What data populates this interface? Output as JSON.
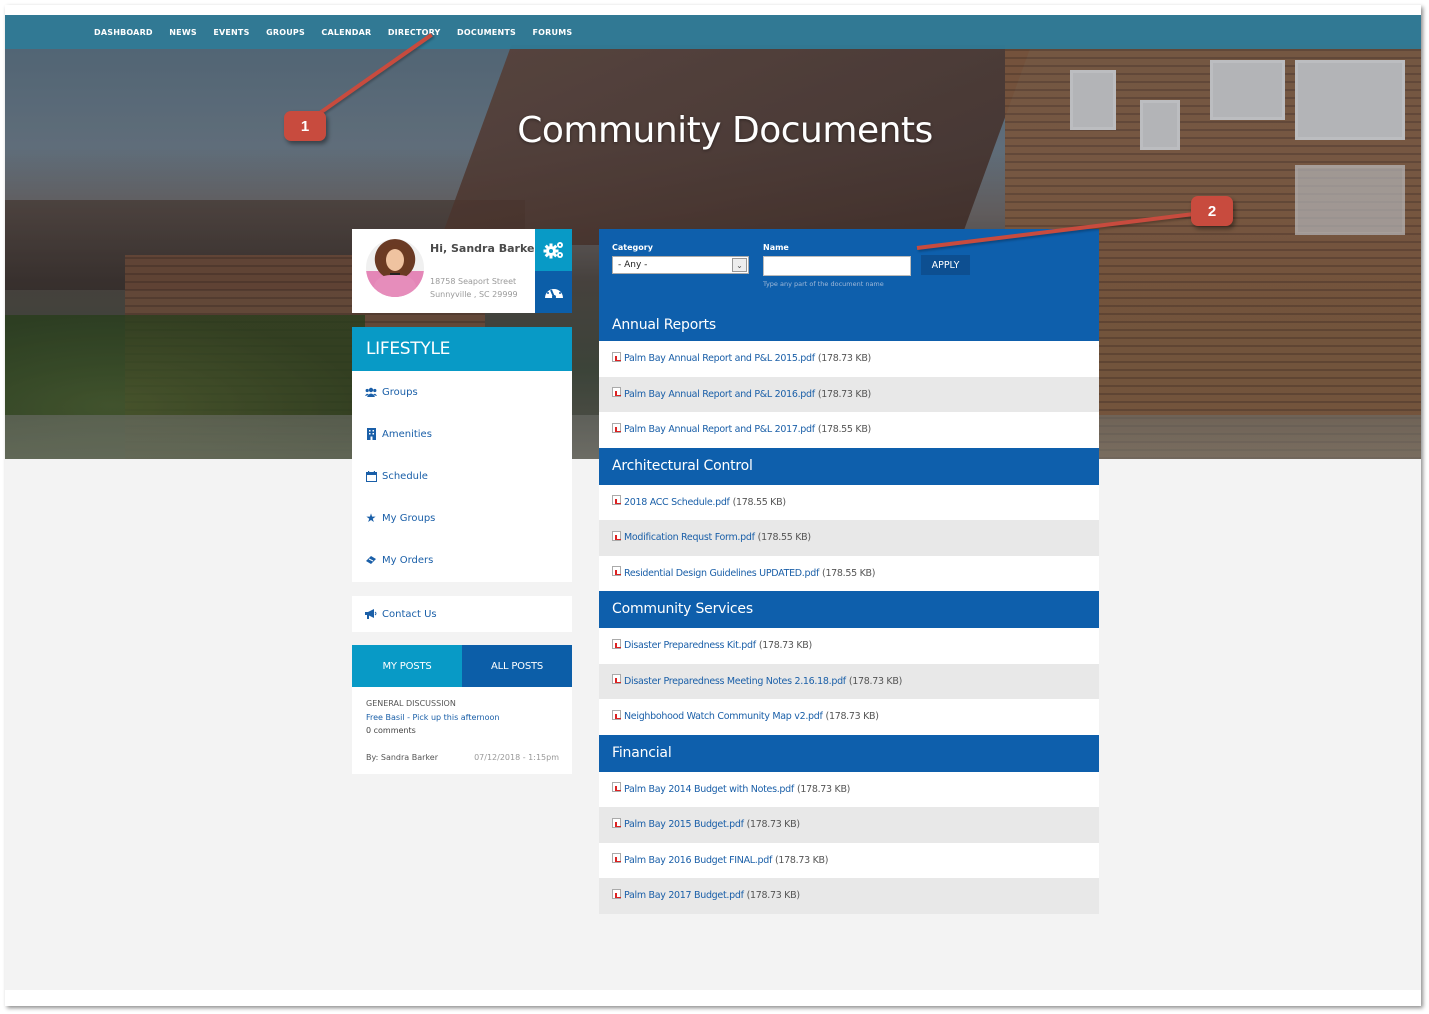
{
  "nav": {
    "items": [
      "DASHBOARD",
      "NEWS",
      "EVENTS",
      "GROUPS",
      "CALENDAR",
      "DIRECTORY",
      "DOCUMENTS",
      "FORUMS"
    ]
  },
  "hero": {
    "title": "Community Documents"
  },
  "callouts": [
    "1",
    "2"
  ],
  "profile": {
    "greeting": "Hi, Sandra Barker",
    "address_line1": "18758 Seaport Street",
    "address_line2": "Sunnyville , SC 29999",
    "settings_icon": "gears-icon",
    "dashboard_icon": "speedometer-icon"
  },
  "sidebar": {
    "heading": "LIFESTYLE",
    "items": [
      {
        "label": "Groups",
        "icon": "users-icon"
      },
      {
        "label": "Amenities",
        "icon": "building-icon"
      },
      {
        "label": "Schedule",
        "icon": "calendar-icon"
      },
      {
        "label": "My Groups",
        "icon": "star-icon"
      },
      {
        "label": "My Orders",
        "icon": "ticket-icon"
      }
    ],
    "contact": {
      "label": "Contact Us",
      "icon": "megaphone-icon"
    }
  },
  "posts": {
    "tabs": [
      "MY POSTS",
      "ALL POSTS"
    ],
    "item": {
      "category": "GENERAL DISCUSSION",
      "title": "Free Basil - Pick up this afternoon",
      "comments": "0 comments",
      "author": "By: Sandra Barker",
      "date": "07/12/2018 - 1:15pm"
    }
  },
  "filter": {
    "category_label": "Category",
    "category_value": "- Any -",
    "name_label": "Name",
    "name_value": "",
    "name_hint": "Type any part of the document name",
    "apply_label": "APPLY"
  },
  "sections": [
    {
      "title": "Annual Reports",
      "docs": [
        {
          "name": "Palm Bay Annual Report and P&L 2015.pdf",
          "size": "(178.73 KB)"
        },
        {
          "name": "Palm Bay Annual Report and P&L 2016.pdf",
          "size": "(178.73 KB)"
        },
        {
          "name": "Palm Bay Annual Report and P&L 2017.pdf",
          "size": "(178.55 KB)"
        }
      ]
    },
    {
      "title": "Architectural Control",
      "docs": [
        {
          "name": "2018 ACC Schedule.pdf",
          "size": "(178.55 KB)"
        },
        {
          "name": "Modification Requst Form.pdf",
          "size": "(178.55 KB)"
        },
        {
          "name": "Residential Design Guidelines UPDATED.pdf",
          "size": "(178.55 KB)"
        }
      ]
    },
    {
      "title": "Community Services",
      "docs": [
        {
          "name": "Disaster Preparedness Kit.pdf",
          "size": "(178.73 KB)"
        },
        {
          "name": "Disaster Preparedness Meeting Notes 2.16.18.pdf",
          "size": "(178.73 KB)"
        },
        {
          "name": "Neighbohood Watch Community Map v2.pdf",
          "size": "(178.73 KB)"
        }
      ]
    },
    {
      "title": "Financial",
      "docs": [
        {
          "name": "Palm Bay 2014 Budget with Notes.pdf",
          "size": "(178.73 KB)"
        },
        {
          "name": "Palm Bay 2015 Budget.pdf",
          "size": "(178.73 KB)"
        },
        {
          "name": "Palm Bay 2016 Budget FINAL.pdf",
          "size": "(178.73 KB)"
        },
        {
          "name": "Palm Bay 2017 Budget.pdf",
          "size": "(178.73 KB)"
        }
      ]
    }
  ],
  "colors": {
    "nav_bar": "#2f7a96",
    "accent_light": "#089ac6",
    "accent_dark": "#0e5fac",
    "link": "#1a5fa8",
    "callout": "#c84b3e"
  }
}
